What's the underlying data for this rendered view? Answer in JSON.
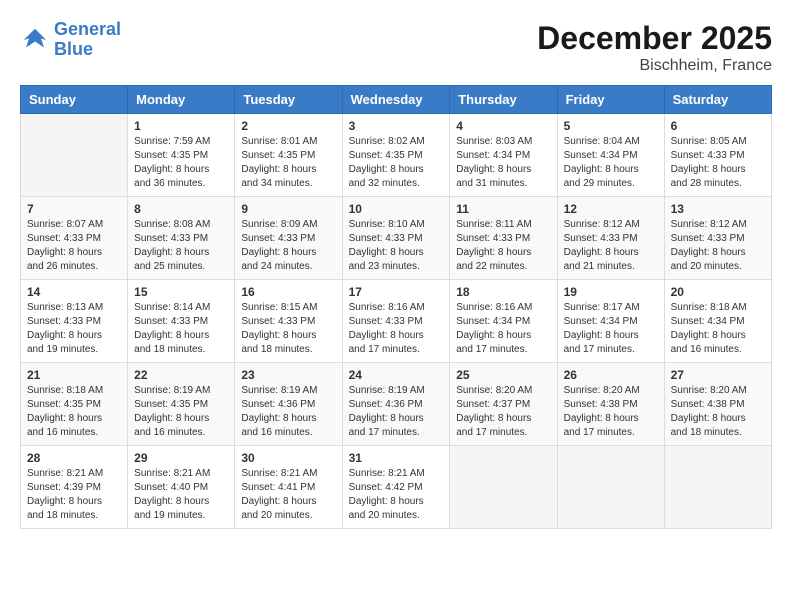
{
  "logo": {
    "line1": "General",
    "line2": "Blue"
  },
  "title": "December 2025",
  "location": "Bischheim, France",
  "days_of_week": [
    "Sunday",
    "Monday",
    "Tuesday",
    "Wednesday",
    "Thursday",
    "Friday",
    "Saturday"
  ],
  "weeks": [
    [
      {
        "day": "",
        "info": ""
      },
      {
        "day": "1",
        "info": "Sunrise: 7:59 AM\nSunset: 4:35 PM\nDaylight: 8 hours\nand 36 minutes."
      },
      {
        "day": "2",
        "info": "Sunrise: 8:01 AM\nSunset: 4:35 PM\nDaylight: 8 hours\nand 34 minutes."
      },
      {
        "day": "3",
        "info": "Sunrise: 8:02 AM\nSunset: 4:35 PM\nDaylight: 8 hours\nand 32 minutes."
      },
      {
        "day": "4",
        "info": "Sunrise: 8:03 AM\nSunset: 4:34 PM\nDaylight: 8 hours\nand 31 minutes."
      },
      {
        "day": "5",
        "info": "Sunrise: 8:04 AM\nSunset: 4:34 PM\nDaylight: 8 hours\nand 29 minutes."
      },
      {
        "day": "6",
        "info": "Sunrise: 8:05 AM\nSunset: 4:33 PM\nDaylight: 8 hours\nand 28 minutes."
      }
    ],
    [
      {
        "day": "7",
        "info": "Sunrise: 8:07 AM\nSunset: 4:33 PM\nDaylight: 8 hours\nand 26 minutes."
      },
      {
        "day": "8",
        "info": "Sunrise: 8:08 AM\nSunset: 4:33 PM\nDaylight: 8 hours\nand 25 minutes."
      },
      {
        "day": "9",
        "info": "Sunrise: 8:09 AM\nSunset: 4:33 PM\nDaylight: 8 hours\nand 24 minutes."
      },
      {
        "day": "10",
        "info": "Sunrise: 8:10 AM\nSunset: 4:33 PM\nDaylight: 8 hours\nand 23 minutes."
      },
      {
        "day": "11",
        "info": "Sunrise: 8:11 AM\nSunset: 4:33 PM\nDaylight: 8 hours\nand 22 minutes."
      },
      {
        "day": "12",
        "info": "Sunrise: 8:12 AM\nSunset: 4:33 PM\nDaylight: 8 hours\nand 21 minutes."
      },
      {
        "day": "13",
        "info": "Sunrise: 8:12 AM\nSunset: 4:33 PM\nDaylight: 8 hours\nand 20 minutes."
      }
    ],
    [
      {
        "day": "14",
        "info": "Sunrise: 8:13 AM\nSunset: 4:33 PM\nDaylight: 8 hours\nand 19 minutes."
      },
      {
        "day": "15",
        "info": "Sunrise: 8:14 AM\nSunset: 4:33 PM\nDaylight: 8 hours\nand 18 minutes."
      },
      {
        "day": "16",
        "info": "Sunrise: 8:15 AM\nSunset: 4:33 PM\nDaylight: 8 hours\nand 18 minutes."
      },
      {
        "day": "17",
        "info": "Sunrise: 8:16 AM\nSunset: 4:33 PM\nDaylight: 8 hours\nand 17 minutes."
      },
      {
        "day": "18",
        "info": "Sunrise: 8:16 AM\nSunset: 4:34 PM\nDaylight: 8 hours\nand 17 minutes."
      },
      {
        "day": "19",
        "info": "Sunrise: 8:17 AM\nSunset: 4:34 PM\nDaylight: 8 hours\nand 17 minutes."
      },
      {
        "day": "20",
        "info": "Sunrise: 8:18 AM\nSunset: 4:34 PM\nDaylight: 8 hours\nand 16 minutes."
      }
    ],
    [
      {
        "day": "21",
        "info": "Sunrise: 8:18 AM\nSunset: 4:35 PM\nDaylight: 8 hours\nand 16 minutes."
      },
      {
        "day": "22",
        "info": "Sunrise: 8:19 AM\nSunset: 4:35 PM\nDaylight: 8 hours\nand 16 minutes."
      },
      {
        "day": "23",
        "info": "Sunrise: 8:19 AM\nSunset: 4:36 PM\nDaylight: 8 hours\nand 16 minutes."
      },
      {
        "day": "24",
        "info": "Sunrise: 8:19 AM\nSunset: 4:36 PM\nDaylight: 8 hours\nand 17 minutes."
      },
      {
        "day": "25",
        "info": "Sunrise: 8:20 AM\nSunset: 4:37 PM\nDaylight: 8 hours\nand 17 minutes."
      },
      {
        "day": "26",
        "info": "Sunrise: 8:20 AM\nSunset: 4:38 PM\nDaylight: 8 hours\nand 17 minutes."
      },
      {
        "day": "27",
        "info": "Sunrise: 8:20 AM\nSunset: 4:38 PM\nDaylight: 8 hours\nand 18 minutes."
      }
    ],
    [
      {
        "day": "28",
        "info": "Sunrise: 8:21 AM\nSunset: 4:39 PM\nDaylight: 8 hours\nand 18 minutes."
      },
      {
        "day": "29",
        "info": "Sunrise: 8:21 AM\nSunset: 4:40 PM\nDaylight: 8 hours\nand 19 minutes."
      },
      {
        "day": "30",
        "info": "Sunrise: 8:21 AM\nSunset: 4:41 PM\nDaylight: 8 hours\nand 20 minutes."
      },
      {
        "day": "31",
        "info": "Sunrise: 8:21 AM\nSunset: 4:42 PM\nDaylight: 8 hours\nand 20 minutes."
      },
      {
        "day": "",
        "info": ""
      },
      {
        "day": "",
        "info": ""
      },
      {
        "day": "",
        "info": ""
      }
    ]
  ]
}
